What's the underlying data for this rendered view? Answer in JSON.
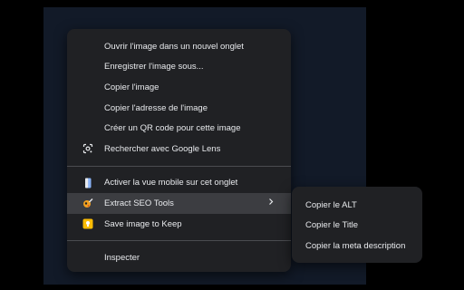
{
  "context_menu": {
    "group1": [
      {
        "label": "Ouvrir l'image dans un nouvel onglet"
      },
      {
        "label": "Enregistrer l'image sous..."
      },
      {
        "label": "Copier l'image"
      },
      {
        "label": "Copier l'adresse de l'image"
      },
      {
        "label": "Créer un QR code pour cette image"
      },
      {
        "label": "Rechercher avec Google Lens",
        "icon": "google-lens-icon"
      }
    ],
    "group2": [
      {
        "label": "Activer la vue mobile sur cet onglet",
        "icon": "mobile-view-icon"
      },
      {
        "label": "Extract SEO Tools",
        "icon": "seo-tools-icon",
        "highlighted": true,
        "has_submenu": true
      },
      {
        "label": "Save image to Keep",
        "icon": "keep-icon"
      }
    ],
    "group3": [
      {
        "label": "Inspecter"
      }
    ]
  },
  "submenu": {
    "items": [
      {
        "label": "Copier le ALT"
      },
      {
        "label": "Copier le Title"
      },
      {
        "label": "Copier la meta description"
      }
    ]
  },
  "colors": {
    "menu_bg": "#202124",
    "highlight": "#3c3d41",
    "text": "#e8eaed",
    "keep_yellow": "#fbbc04",
    "mobile_blue": "#8ab4f8"
  }
}
